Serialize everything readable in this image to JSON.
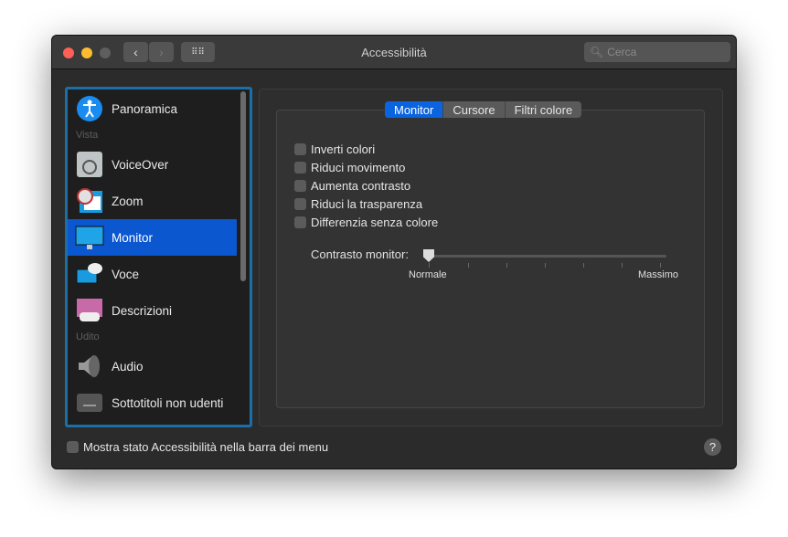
{
  "window": {
    "title": "Accessibilità",
    "search_placeholder": "Cerca"
  },
  "sidebar": {
    "items": [
      {
        "label": "Panoramica"
      },
      {
        "header": "Vista"
      },
      {
        "label": "VoiceOver"
      },
      {
        "label": "Zoom"
      },
      {
        "label": "Monitor",
        "selected": true
      },
      {
        "label": "Voce"
      },
      {
        "label": "Descrizioni"
      },
      {
        "header": "Udito"
      },
      {
        "label": "Audio"
      },
      {
        "label": "Sottotitoli non udenti"
      }
    ]
  },
  "tabs": [
    {
      "label": "Monitor",
      "active": true
    },
    {
      "label": "Cursore"
    },
    {
      "label": "Filtri colore"
    }
  ],
  "options": [
    {
      "label": "Inverti colori",
      "checked": false
    },
    {
      "label": "Riduci movimento",
      "checked": false
    },
    {
      "label": "Aumenta contrasto",
      "checked": false
    },
    {
      "label": "Riduci la trasparenza",
      "checked": false
    },
    {
      "label": "Differenzia senza colore",
      "checked": false
    }
  ],
  "contrast": {
    "label": "Contrasto monitor:",
    "min_label": "Normale",
    "max_label": "Massimo",
    "value": 0
  },
  "footer": {
    "checkbox_label": "Mostra stato Accessibilità nella barra dei menu",
    "checked": false,
    "help": "?"
  },
  "colors": {
    "accent": "#0a57d0",
    "focus_ring": "#1a6fa8"
  }
}
